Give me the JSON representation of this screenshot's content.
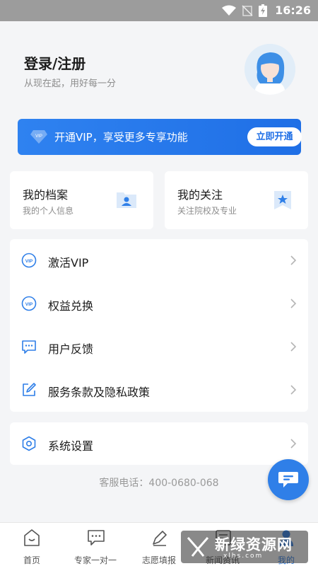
{
  "status_bar": {
    "time": "16:26"
  },
  "header": {
    "title": "登录/注册",
    "subtitle": "从现在起，用好每一分"
  },
  "vip_banner": {
    "text": "开通VIP，享受更多专享功能",
    "button": "立即开通"
  },
  "cards": [
    {
      "title": "我的档案",
      "subtitle": "我的个人信息",
      "icon": "profile-icon"
    },
    {
      "title": "我的关注",
      "subtitle": "关注院校及专业",
      "icon": "star-bookmark-icon"
    }
  ],
  "menu": {
    "items": [
      {
        "label": "激活VIP",
        "icon": "vip-icon"
      },
      {
        "label": "权益兑换",
        "icon": "vip-icon"
      },
      {
        "label": "用户反馈",
        "icon": "chat-icon"
      },
      {
        "label": "服务条款及隐私政策",
        "icon": "edit-icon"
      }
    ]
  },
  "settings": {
    "label": "系统设置",
    "icon": "settings-icon"
  },
  "service_phone": "客服电话：400-0680-068",
  "tabbar": {
    "tabs": [
      {
        "label": "首页",
        "icon": "home-icon"
      },
      {
        "label": "专家一对一",
        "icon": "chat-icon"
      },
      {
        "label": "志愿填报",
        "icon": "pen-icon"
      },
      {
        "label": "新闻资讯",
        "icon": "news-icon"
      },
      {
        "label": "我的",
        "icon": "user-icon",
        "active": true
      }
    ]
  },
  "watermark": {
    "text": "新绿资源网",
    "url": "xlhs.com"
  },
  "colors": {
    "accent": "#2f7fe8",
    "background": "#f4f5f7",
    "status_bar": "#9c9c9c"
  }
}
